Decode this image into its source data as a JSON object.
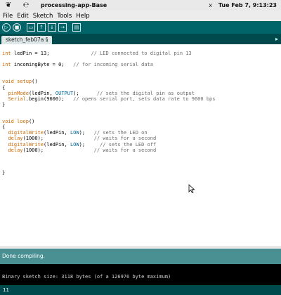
{
  "topbar": {
    "app_title": "processing-app-Base",
    "clock": "Tue Feb 7, 9:13:23",
    "close_glyph": "x"
  },
  "menubar": [
    "File",
    "Edit",
    "Sketch",
    "Tools",
    "Help"
  ],
  "toolbar": {
    "buttons": [
      {
        "name": "verify-button",
        "glyph": "▷"
      },
      {
        "name": "stop-button",
        "glyph": "■"
      },
      {
        "name": "new-button",
        "glyph": "▭"
      },
      {
        "name": "open-button",
        "glyph": "↑"
      },
      {
        "name": "save-button",
        "glyph": "↓"
      },
      {
        "name": "upload-button",
        "glyph": "→"
      },
      {
        "name": "serial-monitor-button",
        "glyph": "▤"
      }
    ]
  },
  "tab": {
    "label": "sketch_feb07a §",
    "arrow": "▸"
  },
  "editor": {
    "lines": [
      [
        [
          "int ",
          ""
        ],
        [
          "ledPin",
          ""
        ],
        [
          " = 13;              // LED connected to digital pin 13",
          "cm_from_slash"
        ]
      ]
    ]
  },
  "status": "Done compiling.",
  "console": "Binary sketch size: 3118 bytes (of a 126976 byte maximum)",
  "footer": "11",
  "colors": {
    "toolbar": "#006468",
    "tabbar": "#004a4e",
    "status": "#4a8f92",
    "keyword": "#cc6600",
    "constant": "#006699",
    "comment": "#6b6b6b"
  }
}
